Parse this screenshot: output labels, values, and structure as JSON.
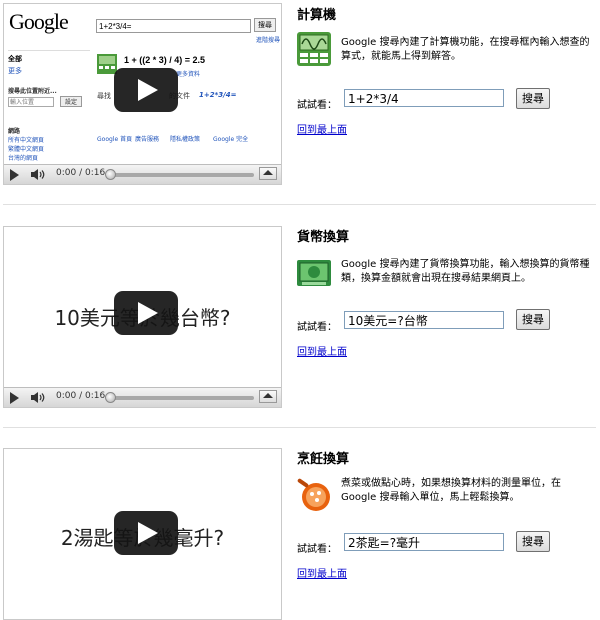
{
  "sections": [
    {
      "title": "計算機",
      "description": "Google 搜尋內建了計算機功能，在搜尋框內輸入想查的算式，就能馬上得到解答。",
      "try_label": "試試看：",
      "try_value": "1+2*3/4",
      "try_button": "搜尋",
      "top_link": "回到最上面",
      "video": {
        "time": "0:00 / 0:16",
        "google": {
          "logo": "Google",
          "query": "1+2*3/4=",
          "search_button": "搜尋",
          "advanced_link": "進階搜尋",
          "sidebar_all": "全部",
          "sidebar_more": "更多",
          "nearby_title": "搜尋此位置附近...",
          "location_placeholder": "輸入位置",
          "set_button": "設定",
          "web_heading": "網路",
          "web_options": [
            "所有中文網頁",
            "繁體中文網頁",
            "台灣的網頁"
          ],
          "result": "1 + ((2 * 3) / 4) = 2.5",
          "more_info": "更多資料",
          "find_text": "尋找",
          "find_suffix": "的文件",
          "find_query": "1+2*3/4=",
          "footer_links": [
            "Google 首頁",
            "廣告服務",
            "隱私權政策",
            "Google 完全"
          ]
        }
      }
    },
    {
      "title": "貨幣換算",
      "description": "Google 搜尋內建了貨幣換算功能，輸入想換算的貨幣種類，換算金額就會出現在搜尋結果網頁上。",
      "try_label": "試試看：",
      "try_value": "10美元=?台幣",
      "try_button": "搜尋",
      "top_link": "回到最上面",
      "video": {
        "time": "0:00 / 0:16",
        "overlay_text": "10美元等於幾台幣?"
      }
    },
    {
      "title": "烹飪換算",
      "description": "煮菜或做點心時，如果想換算材料的測量單位，在 Google 搜尋輸入單位，馬上輕鬆換算。",
      "try_label": "試試看：",
      "try_value": "2茶匙=?毫升",
      "try_button": "搜尋",
      "top_link": "回到最上面",
      "video": {
        "overlay_text": "2湯匙等於幾毫升?"
      }
    }
  ],
  "colors": {
    "link": "#0000cc",
    "calc_icon_bg": "#4a9a3a",
    "currency_icon_bg": "#2e8b3e",
    "cooking_icon_bg": "#e8620e"
  },
  "icons": [
    "calculator-icon",
    "currency-icon",
    "measuring-spoons-icon"
  ]
}
